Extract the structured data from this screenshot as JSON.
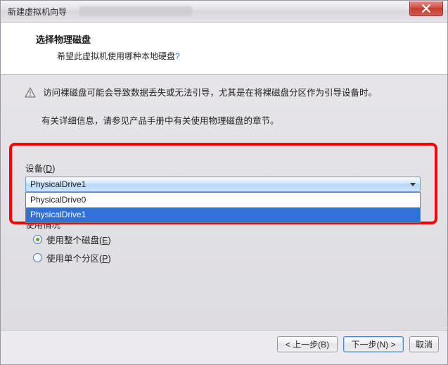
{
  "window": {
    "title": "新建虚拟机向导"
  },
  "header": {
    "title": "选择物理磁盘",
    "subtitle": "希望此虚拟机使用哪种本地硬盘",
    "question_mark": "?"
  },
  "warning": {
    "text": "访问裸磁盘可能会导致数据丢失或无法引导，尤其是在将裸磁盘分区作为引导设备时。",
    "info": "有关详细信息，请参见产品手册中有关使用物理磁盘的章节。"
  },
  "device": {
    "label_prefix": "设备(",
    "label_key": "D",
    "label_suffix": ")",
    "selected": "PhysicalDrive1",
    "options": [
      "PhysicalDrive0",
      "PhysicalDrive1"
    ],
    "selected_index": 1
  },
  "usage": {
    "partial_label": "使用情况",
    "entire_prefix": "使用整个磁盘(",
    "entire_key": "E",
    "entire_suffix": ")",
    "partition_prefix": "使用单个分区(",
    "partition_key": "P",
    "partition_suffix": ")",
    "selected": "entire"
  },
  "footer": {
    "back": "< 上一步(B)",
    "next": "下一步(N) >",
    "cancel": "取消"
  }
}
